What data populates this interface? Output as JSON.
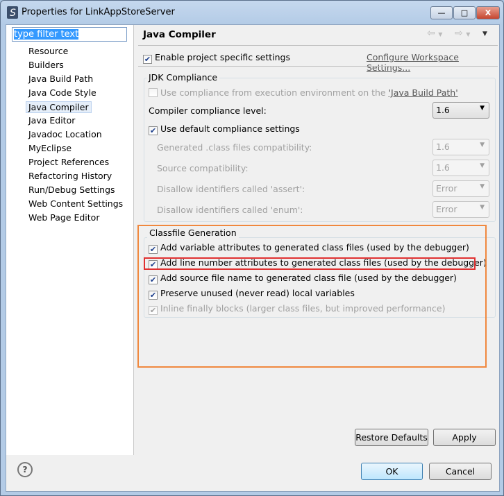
{
  "window": {
    "title": "Properties for LinkAppStoreServer",
    "minimize": "—",
    "maximize": "□",
    "close": "X"
  },
  "filter": {
    "value": "type filter text"
  },
  "tree": [
    "Resource",
    "Builders",
    "Java Build Path",
    "Java Code Style",
    "Java Compiler",
    "Java Editor",
    "Javadoc Location",
    "MyEclipse",
    "Project References",
    "Refactoring History",
    "Run/Debug Settings",
    "Web Content Settings",
    "Web Page Editor"
  ],
  "selected_tree_item": "Java Compiler",
  "page": {
    "title": "Java Compiler",
    "enable_label": "Enable project specific settings",
    "enable_checked": true,
    "configure_link": "Configure Workspace Settings..."
  },
  "jdk": {
    "group_label": "JDK Compliance",
    "use_env_label": "Use compliance from execution environment on the ",
    "use_env_link": "'Java Build Path'",
    "level_label": "Compiler compliance level:",
    "level_value": "1.6",
    "use_default_label": "Use default compliance settings",
    "rows": [
      {
        "label": "Generated .class files compatibility:",
        "value": "1.6"
      },
      {
        "label": "Source compatibility:",
        "value": "1.6"
      },
      {
        "label": "Disallow identifiers called 'assert':",
        "value": "Error"
      },
      {
        "label": "Disallow identifiers called 'enum':",
        "value": "Error"
      }
    ]
  },
  "classfile": {
    "group_label": "Classfile Generation",
    "options": [
      {
        "label": "Add variable attributes to generated class files (used by the debugger)",
        "checked": true,
        "enabled": true
      },
      {
        "label": "Add line number attributes to generated class files (used by the debugger)",
        "checked": true,
        "enabled": true
      },
      {
        "label": "Add source file name to generated class file (used by the debugger)",
        "checked": true,
        "enabled": true
      },
      {
        "label": "Preserve unused (never read) local variables",
        "checked": true,
        "enabled": true
      },
      {
        "label": "Inline finally blocks (larger class files, but improved performance)",
        "checked": true,
        "enabled": false
      }
    ]
  },
  "buttons": {
    "restore": "Restore Defaults",
    "apply": "Apply",
    "ok": "OK",
    "cancel": "Cancel",
    "help": "?"
  },
  "colors": {
    "orange_highlight": "#f0883e",
    "red_highlight": "#e03030",
    "selection": "#3399ff"
  }
}
